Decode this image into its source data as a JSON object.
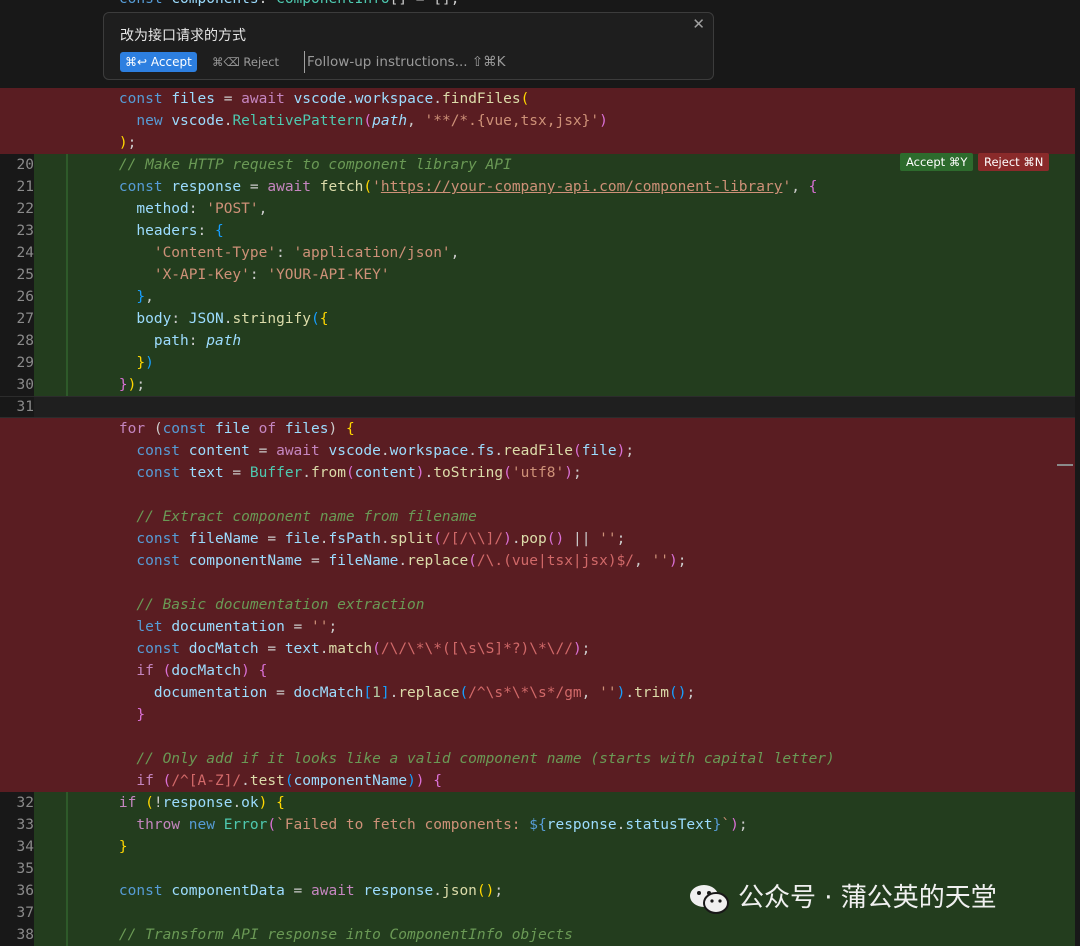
{
  "prompt_box": {
    "title": "改为接口请求的方式",
    "accept_label": "⌘↩ Accept",
    "reject_label": "⌘⌫ Reject",
    "followup_placeholder": "Follow-up instructions... ⇧⌘K",
    "close_symbol": "✕"
  },
  "hunk_actions": {
    "accept_label": "Accept ⌘Y",
    "reject_label": "Reject ⌘N"
  },
  "watermark": {
    "text": "公众号 · 蒲公英的天堂"
  },
  "colors": {
    "deleted_bg": "#5a1d22",
    "inserted_bg": "#233d1e",
    "accept_blue": "#2d7fe0"
  },
  "lines": [
    {
      "type": "del",
      "n": "",
      "t": [
        [
          "    ",
          ""
        ],
        [
          "const ",
          "kw"
        ],
        [
          "files",
          "var"
        ],
        [
          " = ",
          ""
        ],
        [
          "await ",
          "ctl"
        ],
        [
          "vscode",
          "var"
        ],
        [
          ".",
          ""
        ],
        [
          "workspace",
          "var"
        ],
        [
          ".",
          ""
        ],
        [
          "findFiles",
          "fn"
        ],
        [
          "(",
          "br1"
        ]
      ]
    },
    {
      "type": "del",
      "n": "",
      "t": [
        [
          "      ",
          ""
        ],
        [
          "new ",
          "kw"
        ],
        [
          "vscode",
          "var"
        ],
        [
          ".",
          ""
        ],
        [
          "RelativePattern",
          "cls"
        ],
        [
          "(",
          "br2"
        ],
        [
          "path",
          "var it"
        ],
        [
          ", ",
          ""
        ],
        [
          "'**/*.{vue,tsx,jsx}'",
          "str"
        ],
        [
          ")",
          "br2"
        ]
      ]
    },
    {
      "type": "del",
      "n": "",
      "t": [
        [
          "    ",
          ""
        ],
        [
          ")",
          "br1"
        ],
        [
          ";",
          ""
        ]
      ]
    },
    {
      "type": "ins",
      "n": "20",
      "t": [
        [
          "    ",
          ""
        ],
        [
          "// Make HTTP request to component library API",
          "cm"
        ]
      ]
    },
    {
      "type": "ins",
      "n": "21",
      "t": [
        [
          "    ",
          ""
        ],
        [
          "const ",
          "kw"
        ],
        [
          "response",
          "var"
        ],
        [
          " = ",
          ""
        ],
        [
          "await ",
          "ctl"
        ],
        [
          "fetch",
          "fn"
        ],
        [
          "(",
          "br1"
        ],
        [
          "'",
          "str"
        ],
        [
          "https://your-company-api.com/component-library",
          "url"
        ],
        [
          "'",
          "str"
        ],
        [
          ", ",
          ""
        ],
        [
          "{",
          "br2"
        ]
      ]
    },
    {
      "type": "ins",
      "n": "22",
      "t": [
        [
          "      ",
          ""
        ],
        [
          "method",
          "pr"
        ],
        [
          ": ",
          ""
        ],
        [
          "'POST'",
          "str"
        ],
        [
          ",",
          ""
        ]
      ]
    },
    {
      "type": "ins",
      "n": "23",
      "t": [
        [
          "      ",
          ""
        ],
        [
          "headers",
          "pr"
        ],
        [
          ": ",
          ""
        ],
        [
          "{",
          "br3"
        ]
      ]
    },
    {
      "type": "ins",
      "n": "24",
      "t": [
        [
          "        ",
          ""
        ],
        [
          "'Content-Type'",
          "str"
        ],
        [
          ": ",
          ""
        ],
        [
          "'application/json'",
          "str"
        ],
        [
          ",",
          ""
        ]
      ]
    },
    {
      "type": "ins",
      "n": "25",
      "t": [
        [
          "        ",
          ""
        ],
        [
          "'X-API-Key'",
          "str"
        ],
        [
          ": ",
          ""
        ],
        [
          "'YOUR-API-KEY'",
          "str"
        ]
      ]
    },
    {
      "type": "ins",
      "n": "26",
      "t": [
        [
          "      ",
          ""
        ],
        [
          "}",
          "br3"
        ],
        [
          ",",
          ""
        ]
      ]
    },
    {
      "type": "ins",
      "n": "27",
      "t": [
        [
          "      ",
          ""
        ],
        [
          "body",
          "pr"
        ],
        [
          ": ",
          ""
        ],
        [
          "JSON",
          "var"
        ],
        [
          ".",
          ""
        ],
        [
          "stringify",
          "fn"
        ],
        [
          "(",
          "br3"
        ],
        [
          "{",
          "br1"
        ]
      ]
    },
    {
      "type": "ins",
      "n": "28",
      "t": [
        [
          "        ",
          ""
        ],
        [
          "path",
          "pr"
        ],
        [
          ": ",
          ""
        ],
        [
          "path",
          "var it"
        ]
      ]
    },
    {
      "type": "ins",
      "n": "29",
      "t": [
        [
          "      ",
          ""
        ],
        [
          "}",
          "br1"
        ],
        [
          ")",
          "br3"
        ]
      ]
    },
    {
      "type": "ins",
      "n": "30",
      "t": [
        [
          "    ",
          ""
        ],
        [
          "}",
          "br2"
        ],
        [
          ")",
          "br1"
        ],
        [
          ";",
          ""
        ]
      ]
    },
    {
      "type": "cur",
      "n": "31",
      "t": []
    },
    {
      "type": "del",
      "n": "",
      "t": [
        [
          "    ",
          ""
        ],
        [
          "for ",
          "ctl"
        ],
        [
          "(",
          ""
        ],
        [
          "const ",
          "kw"
        ],
        [
          "file ",
          "var"
        ],
        [
          "of ",
          "ctl"
        ],
        [
          "files",
          "var"
        ],
        [
          ") ",
          ""
        ],
        [
          "{",
          "br1"
        ]
      ]
    },
    {
      "type": "del",
      "n": "",
      "t": [
        [
          "      ",
          ""
        ],
        [
          "const ",
          "kw"
        ],
        [
          "content",
          "var"
        ],
        [
          " = ",
          ""
        ],
        [
          "await ",
          "ctl"
        ],
        [
          "vscode",
          "var"
        ],
        [
          ".",
          ""
        ],
        [
          "workspace",
          "var"
        ],
        [
          ".",
          ""
        ],
        [
          "fs",
          "var"
        ],
        [
          ".",
          ""
        ],
        [
          "readFile",
          "fn"
        ],
        [
          "(",
          "br2"
        ],
        [
          "file",
          "var"
        ],
        [
          ")",
          "br2"
        ],
        [
          ";",
          ""
        ]
      ]
    },
    {
      "type": "del",
      "n": "",
      "t": [
        [
          "      ",
          ""
        ],
        [
          "const ",
          "kw"
        ],
        [
          "text",
          "var"
        ],
        [
          " = ",
          ""
        ],
        [
          "Buffer",
          "cls"
        ],
        [
          ".",
          ""
        ],
        [
          "from",
          "fn"
        ],
        [
          "(",
          "br2"
        ],
        [
          "content",
          "var"
        ],
        [
          ")",
          "br2"
        ],
        [
          ".",
          ""
        ],
        [
          "toString",
          "fn"
        ],
        [
          "(",
          "br2"
        ],
        [
          "'utf8'",
          "str"
        ],
        [
          ")",
          "br2"
        ],
        [
          ";",
          ""
        ]
      ]
    },
    {
      "type": "del",
      "n": "",
      "t": []
    },
    {
      "type": "del",
      "n": "",
      "t": [
        [
          "      ",
          ""
        ],
        [
          "// Extract component name from filename",
          "cm"
        ]
      ]
    },
    {
      "type": "del",
      "n": "",
      "t": [
        [
          "      ",
          ""
        ],
        [
          "const ",
          "kw"
        ],
        [
          "fileName",
          "var"
        ],
        [
          " = ",
          ""
        ],
        [
          "file",
          "var"
        ],
        [
          ".",
          ""
        ],
        [
          "fsPath",
          "var"
        ],
        [
          ".",
          ""
        ],
        [
          "split",
          "fn"
        ],
        [
          "(",
          "br2"
        ],
        [
          "/[/\\\\]/",
          "rx"
        ],
        [
          ")",
          "br2"
        ],
        [
          ".",
          ""
        ],
        [
          "pop",
          "fn"
        ],
        [
          "(",
          "br2"
        ],
        [
          ")",
          "br2"
        ],
        [
          " || ",
          ""
        ],
        [
          "''",
          "str"
        ],
        [
          ";",
          ""
        ]
      ]
    },
    {
      "type": "del",
      "n": "",
      "t": [
        [
          "      ",
          ""
        ],
        [
          "const ",
          "kw"
        ],
        [
          "componentName",
          "var"
        ],
        [
          " = ",
          ""
        ],
        [
          "fileName",
          "var"
        ],
        [
          ".",
          ""
        ],
        [
          "replace",
          "fn"
        ],
        [
          "(",
          "br2"
        ],
        [
          "/\\.(vue|tsx|jsx)$/",
          "rx"
        ],
        [
          ", ",
          ""
        ],
        [
          "''",
          "str"
        ],
        [
          ")",
          "br2"
        ],
        [
          ";",
          ""
        ]
      ]
    },
    {
      "type": "del",
      "n": "",
      "t": []
    },
    {
      "type": "del",
      "n": "",
      "t": [
        [
          "      ",
          ""
        ],
        [
          "// Basic documentation extraction",
          "cm"
        ]
      ]
    },
    {
      "type": "del",
      "n": "",
      "t": [
        [
          "      ",
          ""
        ],
        [
          "let ",
          "kw"
        ],
        [
          "documentation",
          "var"
        ],
        [
          " = ",
          ""
        ],
        [
          "''",
          "str"
        ],
        [
          ";",
          ""
        ]
      ]
    },
    {
      "type": "del",
      "n": "",
      "t": [
        [
          "      ",
          ""
        ],
        [
          "const ",
          "kw"
        ],
        [
          "docMatch",
          "var"
        ],
        [
          " = ",
          ""
        ],
        [
          "text",
          "var"
        ],
        [
          ".",
          ""
        ],
        [
          "match",
          "fn"
        ],
        [
          "(",
          "br2"
        ],
        [
          "/\\/\\*\\*([\\s\\S]*?)\\*\\//",
          "rx"
        ],
        [
          ")",
          "br2"
        ],
        [
          ";",
          ""
        ]
      ]
    },
    {
      "type": "del",
      "n": "",
      "t": [
        [
          "      ",
          ""
        ],
        [
          "if ",
          "ctl"
        ],
        [
          "(",
          "br2"
        ],
        [
          "docMatch",
          "var"
        ],
        [
          ") ",
          "br2"
        ],
        [
          "{",
          "br2"
        ]
      ]
    },
    {
      "type": "del",
      "n": "",
      "t": [
        [
          "        ",
          ""
        ],
        [
          "documentation",
          "var"
        ],
        [
          " = ",
          ""
        ],
        [
          "docMatch",
          "var"
        ],
        [
          "[",
          "br3"
        ],
        [
          "1",
          "num"
        ],
        [
          "]",
          "br3"
        ],
        [
          ".",
          ""
        ],
        [
          "replace",
          "fn"
        ],
        [
          "(",
          "br3"
        ],
        [
          "/^\\s*\\*\\s*/gm",
          "rx"
        ],
        [
          ", ",
          ""
        ],
        [
          "''",
          "str"
        ],
        [
          ")",
          "br3"
        ],
        [
          ".",
          ""
        ],
        [
          "trim",
          "fn"
        ],
        [
          "(",
          "br3"
        ],
        [
          ")",
          "br3"
        ],
        [
          ";",
          ""
        ]
      ]
    },
    {
      "type": "del",
      "n": "",
      "t": [
        [
          "      ",
          ""
        ],
        [
          "}",
          "br2"
        ]
      ]
    },
    {
      "type": "del",
      "n": "",
      "t": []
    },
    {
      "type": "del",
      "n": "",
      "t": [
        [
          "      ",
          ""
        ],
        [
          "// Only add if it looks like a valid component name (starts with capital letter)",
          "cm"
        ]
      ]
    },
    {
      "type": "del",
      "n": "",
      "t": [
        [
          "      ",
          ""
        ],
        [
          "if ",
          "ctl"
        ],
        [
          "(",
          "br2"
        ],
        [
          "/^[A-Z]/",
          "rx"
        ],
        [
          ".",
          ""
        ],
        [
          "test",
          "fn"
        ],
        [
          "(",
          "br3"
        ],
        [
          "componentName",
          "var"
        ],
        [
          ")",
          "br3"
        ],
        [
          ")",
          "br2"
        ],
        [
          " {",
          "br2"
        ]
      ]
    },
    {
      "type": "ins",
      "n": "32",
      "t": [
        [
          "    ",
          ""
        ],
        [
          "if ",
          "ctl"
        ],
        [
          "(",
          "br1"
        ],
        [
          "!",
          ""
        ],
        [
          "response",
          "var"
        ],
        [
          ".",
          ""
        ],
        [
          "ok",
          "var"
        ],
        [
          ") ",
          "br1"
        ],
        [
          "{",
          "br1"
        ]
      ]
    },
    {
      "type": "ins",
      "n": "33",
      "t": [
        [
          "      ",
          ""
        ],
        [
          "throw ",
          "ctl"
        ],
        [
          "new ",
          "kw"
        ],
        [
          "Error",
          "cls"
        ],
        [
          "(",
          "br2"
        ],
        [
          "`Failed to fetch components: ",
          "str"
        ],
        [
          "${",
          "kw"
        ],
        [
          "response",
          "var"
        ],
        [
          ".",
          ""
        ],
        [
          "statusText",
          "var"
        ],
        [
          "}",
          "kw"
        ],
        [
          "`",
          "str"
        ],
        [
          ")",
          "br2"
        ],
        [
          ";",
          ""
        ]
      ]
    },
    {
      "type": "ins",
      "n": "34",
      "t": [
        [
          "    ",
          ""
        ],
        [
          "}",
          "br1"
        ]
      ]
    },
    {
      "type": "ins",
      "n": "35",
      "t": []
    },
    {
      "type": "ins",
      "n": "36",
      "t": [
        [
          "    ",
          ""
        ],
        [
          "const ",
          "kw"
        ],
        [
          "componentData",
          "var"
        ],
        [
          " = ",
          ""
        ],
        [
          "await ",
          "ctl"
        ],
        [
          "response",
          "var"
        ],
        [
          ".",
          ""
        ],
        [
          "json",
          "fn"
        ],
        [
          "(",
          "br1"
        ],
        [
          ")",
          "br1"
        ],
        [
          ";",
          ""
        ]
      ]
    },
    {
      "type": "ins",
      "n": "37",
      "t": []
    },
    {
      "type": "ins",
      "n": "38",
      "t": [
        [
          "    ",
          ""
        ],
        [
          "// Transform API response into ComponentInfo objects",
          "cm"
        ]
      ]
    }
  ]
}
